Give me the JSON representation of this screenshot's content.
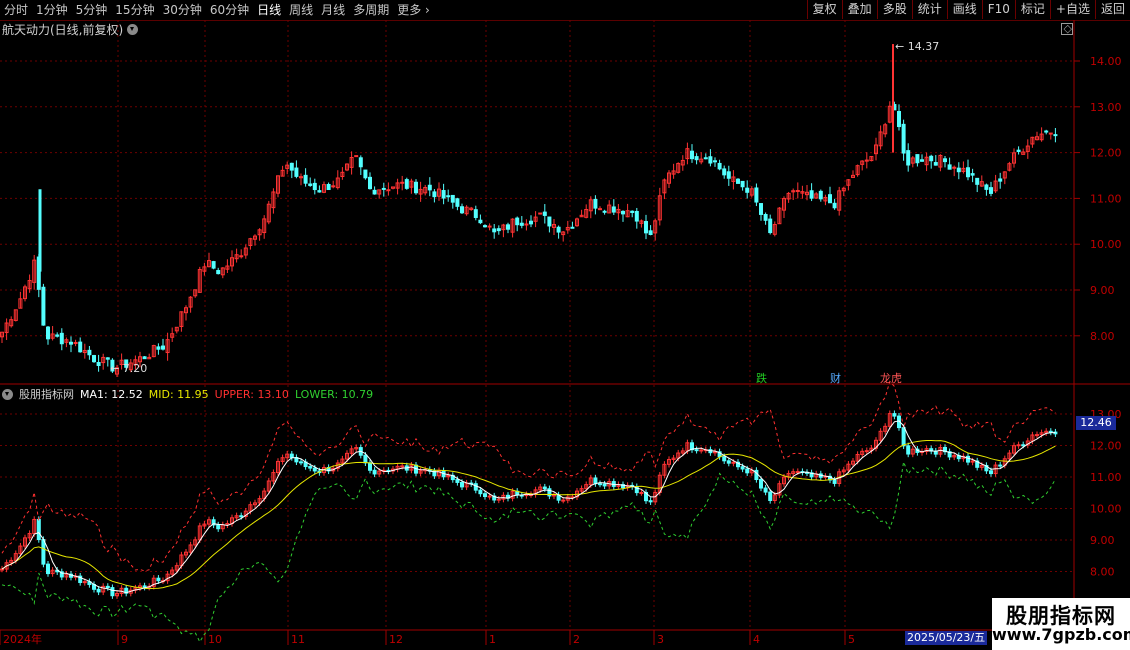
{
  "toolbar": {
    "periods": [
      "分时",
      "1分钟",
      "5分钟",
      "15分钟",
      "30分钟",
      "60分钟",
      "日线",
      "周线",
      "月线",
      "多周期",
      "更多"
    ],
    "active_period": "日线",
    "buttons": [
      "复权",
      "叠加",
      "多股",
      "统计",
      "画线",
      "F10",
      "标记",
      "+自选",
      "返回"
    ]
  },
  "main_pane": {
    "title": "航天动力(日线,前复权)",
    "high_label": "14.37",
    "low_label": "7.20",
    "price_axis": [
      "14.00",
      "13.00",
      "12.00",
      "11.00",
      "10.00",
      "9.00",
      "8.00"
    ],
    "events": [
      {
        "label": "跌",
        "color": "#22cc22"
      },
      {
        "label": "财",
        "color": "#55aaff"
      },
      {
        "label": "龙虎",
        "color": "#ff5555"
      }
    ]
  },
  "indicator_pane": {
    "name": "股朋指标网",
    "ma1": {
      "label": "MA1:",
      "value": "12.52",
      "color": "#ffffff"
    },
    "mid": {
      "label": "MID:",
      "value": "11.95",
      "color": "#e6e600"
    },
    "upper": {
      "label": "UPPER:",
      "value": "13.10",
      "color": "#ff3030"
    },
    "lower": {
      "label": "LOWER:",
      "value": "10.79",
      "color": "#30d030"
    },
    "current_price": "12.46",
    "price_axis": [
      "13.00",
      "12.00",
      "11.00",
      "10.00",
      "9.00",
      "8.00"
    ]
  },
  "date_axis": {
    "labels": [
      "2024年",
      "9",
      "10",
      "11",
      "12",
      "1",
      "2",
      "3",
      "4",
      "5"
    ],
    "cursor_date": "2025/05/23/五"
  },
  "watermark": {
    "line1": "股朋指标网",
    "line2": "www.7gpzb.com"
  },
  "colors": {
    "up": "#ff3333",
    "down": "#54ffff",
    "grid": "#6e0000",
    "bg": "#000000"
  }
}
